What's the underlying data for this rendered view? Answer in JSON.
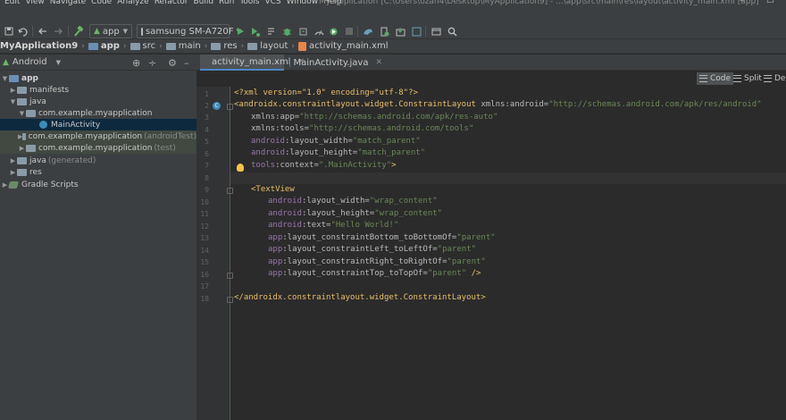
{
  "menu": {
    "items": [
      "Edit",
      "View",
      "Navigate",
      "Code",
      "Analyze",
      "Refactor",
      "Build",
      "Run",
      "Tools",
      "VCS",
      "Window",
      "Help"
    ],
    "window_title": "My Application [C:\\Users\\ozan4\\Desktop\\MyApplication9] - ...\\app\\src\\main\\res\\layout\\activity_main.xml [app]"
  },
  "toolbar": {
    "run_config": "app",
    "device": "samsung SM-A720F"
  },
  "breadcrumb": [
    "MyApplication9",
    "app",
    "src",
    "main",
    "res",
    "layout",
    "activity_main.xml"
  ],
  "project": {
    "view_mode": "Android",
    "tree": [
      {
        "label": "app",
        "bold": true
      },
      {
        "label": "manifests"
      },
      {
        "label": "java"
      },
      {
        "label": "com.example.myapplication"
      },
      {
        "label": "MainActivity"
      },
      {
        "label": "com.example.myapplication",
        "suffix": "(androidTest)"
      },
      {
        "label": "com.example.myapplication",
        "suffix": "(test)"
      },
      {
        "label": "java",
        "suffix": "(generated)"
      },
      {
        "label": "res"
      },
      {
        "label": "Gradle Scripts"
      }
    ]
  },
  "tabs": [
    {
      "label": "activity_main.xml",
      "active": true
    },
    {
      "label": "MainActivity.java",
      "active": false
    }
  ],
  "view_switch": {
    "code": "Code",
    "split": "Split",
    "design": "Des"
  },
  "editor": {
    "line_numbers": [
      "1",
      "2",
      "3",
      "4",
      "5",
      "6",
      "7",
      "8",
      "9",
      "10",
      "11",
      "12",
      "13",
      "14",
      "15",
      "16",
      "17",
      "18"
    ],
    "lines": {
      "l1": "<?xml version=\"1.0\" encoding=\"utf-8\"?>",
      "l2a": "<androidx.constraintlayout.widget.ConstraintLayout ",
      "l2b": "xmlns:android=",
      "l2c": "\"http://schemas.android.com/apk/res/android\"",
      "l3a": "xmlns:app=",
      "l3b": "\"http://schemas.android.com/apk/res-auto\"",
      "l4a": "xmlns:tools=",
      "l4b": "\"http://schemas.android.com/tools\"",
      "l5a": "android",
      "l5b": ":layout_width=",
      "l5c": "\"match_parent\"",
      "l6a": "android",
      "l6b": ":layout_height=",
      "l6c": "\"match_parent\"",
      "l7a": "tools",
      "l7b": ":context=",
      "l7c": "\".MainActivity\"",
      "l7d": ">",
      "l9": "<TextView",
      "l10a": "android",
      "l10b": ":layout_width=",
      "l10c": "\"wrap_content\"",
      "l11a": "android",
      "l11b": ":layout_height=",
      "l11c": "\"wrap_content\"",
      "l12a": "android",
      "l12b": ":text=",
      "l12c": "\"Hello World!\"",
      "l13a": "app",
      "l13b": ":layout_constraintBottom_toBottomOf=",
      "l13c": "\"parent\"",
      "l14a": "app",
      "l14b": ":layout_constraintLeft_toLeftOf=",
      "l14c": "\"parent\"",
      "l15a": "app",
      "l15b": ":layout_constraintRight_toRightOf=",
      "l15c": "\"parent\"",
      "l16a": "app",
      "l16b": ":layout_constraintTop_toTopOf=",
      "l16c": "\"parent\"",
      "l16d": " />",
      "l18": "</androidx.constraintlayout.widget.ConstraintLayout>"
    }
  }
}
